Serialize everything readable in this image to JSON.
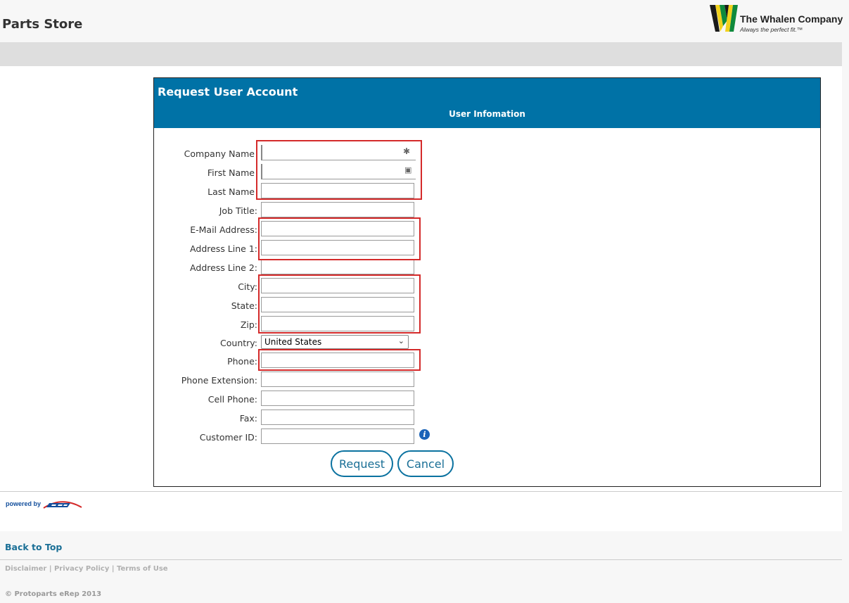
{
  "header": {
    "site_title": "Parts Store",
    "logo_name": "The Whalen Company",
    "logo_tagline": "Always the perfect fit.™"
  },
  "panel": {
    "title": "Request User Account",
    "subtitle": "User Infomation"
  },
  "form": {
    "fields": [
      {
        "label": "Company Name",
        "value": ""
      },
      {
        "label": "First Name",
        "value": ""
      },
      {
        "label": "Last Name",
        "value": ""
      },
      {
        "label": "Job Title:",
        "value": ""
      },
      {
        "label": "E-Mail Address:",
        "value": ""
      },
      {
        "label": "Address Line 1:",
        "value": ""
      },
      {
        "label": "Address Line 2:",
        "value": ""
      },
      {
        "label": "City:",
        "value": ""
      },
      {
        "label": "State:",
        "value": ""
      },
      {
        "label": "Zip:",
        "value": ""
      },
      {
        "label": "Country:",
        "value": "United States"
      },
      {
        "label": "Phone:",
        "value": ""
      },
      {
        "label": "Phone Extension:",
        "value": ""
      },
      {
        "label": "Cell Phone:",
        "value": ""
      },
      {
        "label": "Fax:",
        "value": ""
      },
      {
        "label": "Customer ID:",
        "value": ""
      }
    ],
    "request_label": "Request",
    "cancel_label": "Cancel"
  },
  "colors": {
    "accent": "#0072a6",
    "highlight": "#d42a2a",
    "link": "#1a6f96"
  },
  "footer": {
    "powered_by": "powered by",
    "back_to_top": "Back to Top",
    "links": "Disclaimer | Privacy Policy | Terms of Use",
    "copyright": "© Protoparts eRep 2013"
  }
}
